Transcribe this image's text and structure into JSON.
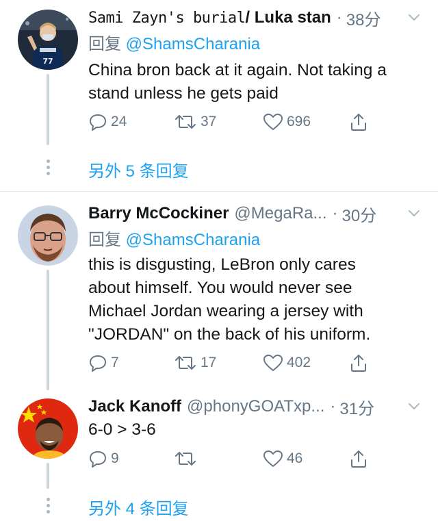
{
  "tweets": [
    {
      "name_prefix": "Sami Zayn's burial",
      "name_suffix": "/ Luka stan",
      "handle": "",
      "sep": "·",
      "time": "38分",
      "reply_label": "回复",
      "reply_to": "@ShamsCharania",
      "text_lines": [
        "China bron back at it again. Not taking a",
        "stand unless he gets paid"
      ],
      "reply_count": "24",
      "retweet_count": "37",
      "like_count": "696",
      "avatar_icon": "basketball-player-avatar",
      "jersey_number": "77"
    },
    {
      "name": "Barry McCockiner",
      "handle": "@MegaRa...",
      "sep": "·",
      "time": "30分",
      "reply_label": "回复",
      "reply_to": "@ShamsCharania",
      "text_lines": [
        "this is disgusting, LeBron only cares",
        "about himself. You would never see",
        "Michael Jordan wearing a jersey with",
        "\"JORDAN\" on the back of his uniform."
      ],
      "reply_count": "7",
      "retweet_count": "17",
      "like_count": "402",
      "avatar_icon": "face-glasses-avatar"
    },
    {
      "name": "Jack Kanoff",
      "handle": "@phonyGOATxp...",
      "sep": "·",
      "time": "31分",
      "text_lines": [
        "6-0 > 3-6"
      ],
      "reply_count": "9",
      "retweet_count": "",
      "like_count": "46",
      "avatar_icon": "china-flag-face-avatar"
    }
  ],
  "more_replies": [
    {
      "label": "另外 5 条回复"
    },
    {
      "label": "另外 4 条回复"
    }
  ],
  "colors": {
    "text": "#14171a",
    "muted": "#657786",
    "link": "#1da1f2",
    "thread_line": "#ccd6dd",
    "divider": "#e1e8ed"
  }
}
